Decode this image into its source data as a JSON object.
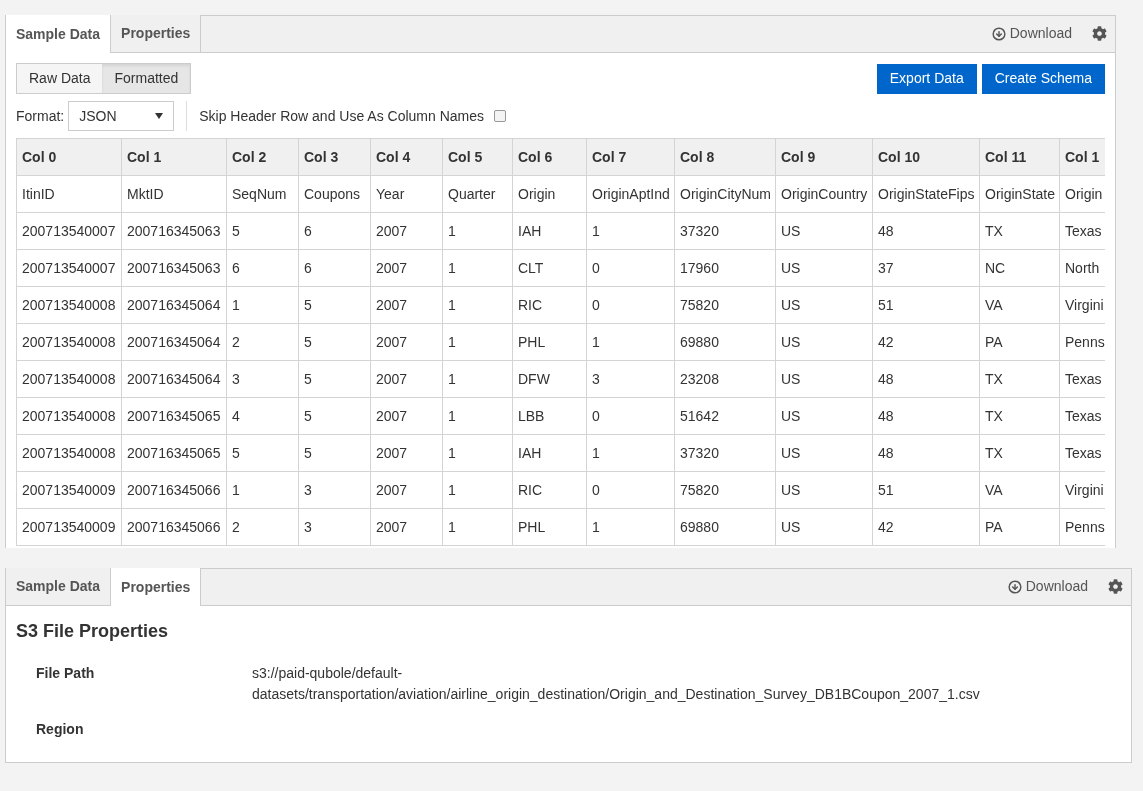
{
  "sample_panel": {
    "tabs": [
      {
        "label": "Sample Data",
        "selected": true
      },
      {
        "label": "Properties",
        "selected": false
      }
    ],
    "download": "Download",
    "view_toggle": [
      {
        "label": "Raw Data",
        "selected": false
      },
      {
        "label": "Formatted",
        "selected": true
      }
    ],
    "buttons": [
      "Export Data",
      "Create Schema"
    ],
    "format": {
      "label": "Format:",
      "value": "JSON"
    },
    "skip_header": {
      "label": "Skip Header Row and Use As Column Names",
      "checked": false
    },
    "table": {
      "columns": [
        "Col 0",
        "Col 1",
        "Col 2",
        "Col 3",
        "Col 4",
        "Col 5",
        "Col 6",
        "Col 7",
        "Col 8",
        "Col 9",
        "Col 10",
        "Col 11",
        "Col 1"
      ],
      "rows": [
        [
          "ItinID",
          "MktID",
          "SeqNum",
          "Coupons",
          "Year",
          "Quarter",
          "Origin",
          "OriginAptInd",
          "OriginCityNum",
          "OriginCountry",
          "OriginStateFips",
          "OriginState",
          "Origin"
        ],
        [
          "200713540007",
          "200716345063",
          "5",
          "6",
          "2007",
          "1",
          "IAH",
          "1",
          "37320",
          "US",
          "48",
          "TX",
          "Texas"
        ],
        [
          "200713540007",
          "200716345063",
          "6",
          "6",
          "2007",
          "1",
          "CLT",
          "0",
          "17960",
          "US",
          "37",
          "NC",
          "North"
        ],
        [
          "200713540008",
          "200716345064",
          "1",
          "5",
          "2007",
          "1",
          "RIC",
          "0",
          "75820",
          "US",
          "51",
          "VA",
          "Virgini"
        ],
        [
          "200713540008",
          "200716345064",
          "2",
          "5",
          "2007",
          "1",
          "PHL",
          "1",
          "69880",
          "US",
          "42",
          "PA",
          "Penns"
        ],
        [
          "200713540008",
          "200716345064",
          "3",
          "5",
          "2007",
          "1",
          "DFW",
          "3",
          "23208",
          "US",
          "48",
          "TX",
          "Texas"
        ],
        [
          "200713540008",
          "200716345065",
          "4",
          "5",
          "2007",
          "1",
          "LBB",
          "0",
          "51642",
          "US",
          "48",
          "TX",
          "Texas"
        ],
        [
          "200713540008",
          "200716345065",
          "5",
          "5",
          "2007",
          "1",
          "IAH",
          "1",
          "37320",
          "US",
          "48",
          "TX",
          "Texas"
        ],
        [
          "200713540009",
          "200716345066",
          "1",
          "3",
          "2007",
          "1",
          "RIC",
          "0",
          "75820",
          "US",
          "51",
          "VA",
          "Virgini"
        ],
        [
          "200713540009",
          "200716345066",
          "2",
          "3",
          "2007",
          "1",
          "PHL",
          "1",
          "69880",
          "US",
          "42",
          "PA",
          "Penns"
        ]
      ]
    }
  },
  "properties_panel": {
    "tabs": [
      {
        "label": "Sample Data",
        "selected": false
      },
      {
        "label": "Properties",
        "selected": true
      }
    ],
    "download": "Download",
    "heading": "S3 File Properties",
    "fields": [
      {
        "label": "File Path",
        "value": "s3://paid-qubole/default-datasets/transportation/aviation/airline_origin_destination/Origin_and_Destination_Survey_DB1BCoupon_2007_1.csv"
      },
      {
        "label": "Region"
      }
    ]
  }
}
